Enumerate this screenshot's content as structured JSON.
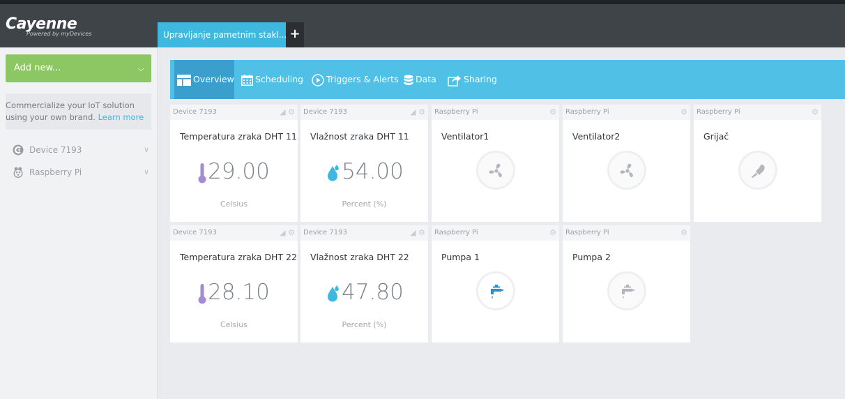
{
  "app": {
    "logo": "Cayenne",
    "logo_sub": "Powered by myDevices",
    "tab_active": "Upravljanje pametnim stakl...",
    "tab_add": "+"
  },
  "sidebar": {
    "add_new": "Add new...",
    "promo_text": "Commercialize your IoT solution using your own brand.",
    "promo_link": "Learn more",
    "devices": [
      {
        "label": "Device 7193",
        "icon": "cayenne-icon"
      },
      {
        "label": "Raspberry Pi",
        "icon": "raspberry-pi-icon"
      }
    ]
  },
  "nav": {
    "items": [
      {
        "label": "Overview",
        "icon": "overview-icon"
      },
      {
        "label": "Scheduling",
        "icon": "calendar-icon"
      },
      {
        "label": "Triggers & Alerts",
        "icon": "play-circle-icon"
      },
      {
        "label": "Data",
        "icon": "database-icon"
      },
      {
        "label": "Sharing",
        "icon": "share-icon"
      }
    ]
  },
  "cards": [
    {
      "device": "Device 7193",
      "title": "Temperatura zraka DHT 11",
      "value": "29.00",
      "unit": "Celsius",
      "icon": "thermometer-icon"
    },
    {
      "device": "Device 7193",
      "title": "Vlažnost zraka DHT 11",
      "value": "54.00",
      "unit": "Percent (%)",
      "icon": "water-drop-icon"
    },
    {
      "device": "Raspberry Pi",
      "title": "Ventilator1",
      "icon": "fan-icon"
    },
    {
      "device": "Raspberry Pi",
      "title": "Ventilator2",
      "icon": "fan-icon"
    },
    {
      "device": "Raspberry Pi",
      "title": "Grijač",
      "icon": "heater-icon"
    },
    {
      "device": "Device 7193",
      "title": "Temperatura zraka DHT 22",
      "value": "28.10",
      "unit": "Celsius",
      "icon": "thermometer-icon"
    },
    {
      "device": "Device 7193",
      "title": "Vlažnost zraka DHT 22",
      "value": "47.80",
      "unit": "Percent (%)",
      "icon": "water-drop-icon"
    },
    {
      "device": "Raspberry Pi",
      "title": "Pumpa 1",
      "icon": "faucet-icon",
      "state": "on"
    },
    {
      "device": "Raspberry Pi",
      "title": "Pumpa 2",
      "icon": "faucet-icon",
      "state": "off"
    }
  ],
  "colors": {
    "accent": "#50c0e7",
    "add_button": "#8cc763",
    "topbar": "#3f4449",
    "thermometer": "#a58bd6",
    "water": "#3fb8e0",
    "active_actuator": "#2a8fcf"
  }
}
